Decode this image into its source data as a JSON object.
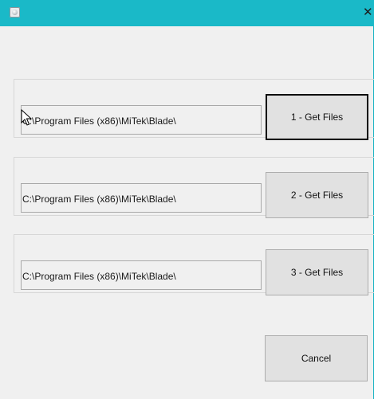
{
  "window": {
    "close_glyph": "✕",
    "app_icon": "gear-icon",
    "accent_color": "#1ab9c8"
  },
  "groups": [
    {
      "path": "C:\\Program Files (x86)\\MiTek\\Blade\\",
      "button_label": "1 - Get Files"
    },
    {
      "path": "C:\\Program Files (x86)\\MiTek\\Blade\\",
      "button_label": "2 - Get Files"
    },
    {
      "path": "C:\\Program Files (x86)\\MiTek\\Blade\\",
      "button_label": "3 - Get Files"
    }
  ],
  "footer": {
    "cancel_label": "Cancel"
  }
}
